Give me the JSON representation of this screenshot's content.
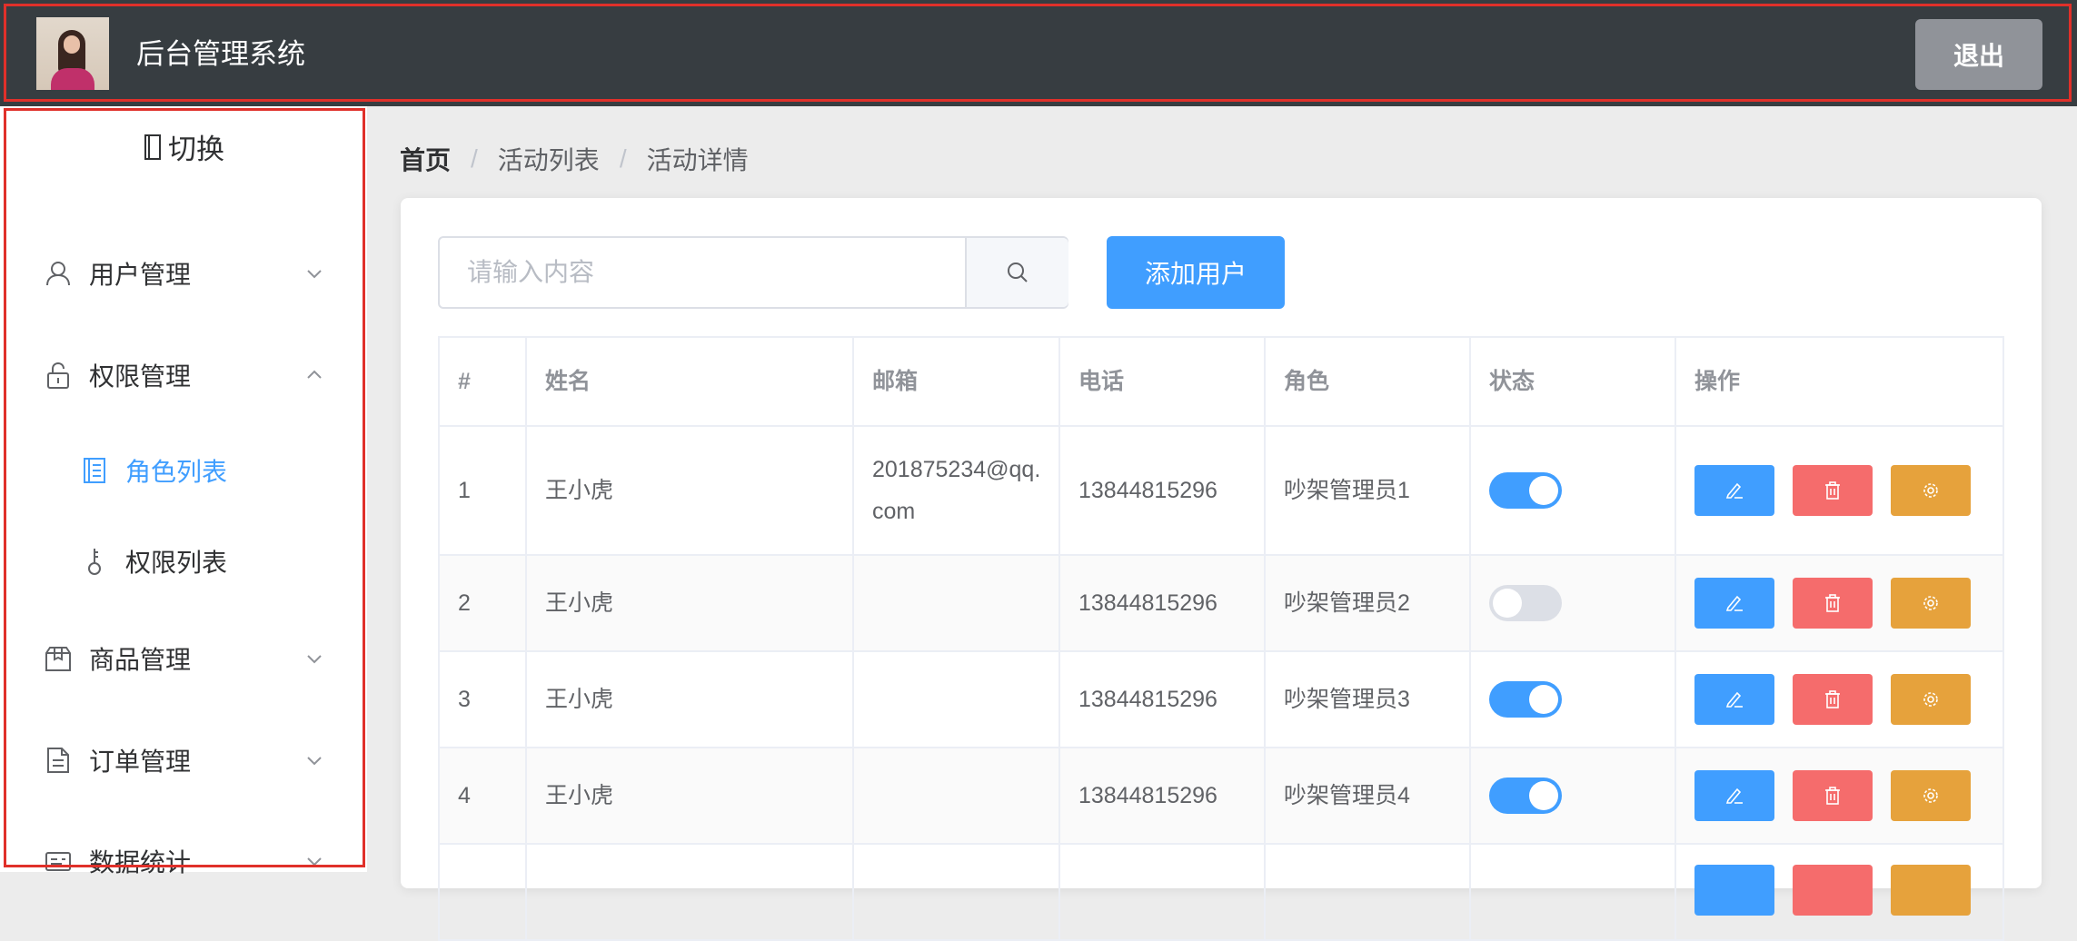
{
  "header": {
    "title": "后台管理系统",
    "logout_label": "退出"
  },
  "sidebar": {
    "toggle_label": "切换",
    "items": [
      {
        "label": "用户管理",
        "icon": "user-icon",
        "expanded": false
      },
      {
        "label": "权限管理",
        "icon": "lock-icon",
        "expanded": true
      },
      {
        "label": "角色列表",
        "icon": "list-icon",
        "sub": true,
        "active": true
      },
      {
        "label": "权限列表",
        "icon": "key-icon",
        "sub": true,
        "active": false
      },
      {
        "label": "商品管理",
        "icon": "box-icon",
        "expanded": false
      },
      {
        "label": "订单管理",
        "icon": "document-icon",
        "expanded": false
      },
      {
        "label": "数据统计",
        "icon": "chart-card-icon",
        "expanded": false
      }
    ]
  },
  "breadcrumb": [
    "首页",
    "活动列表",
    "活动详情"
  ],
  "search": {
    "placeholder": "请输入内容",
    "value": ""
  },
  "add_button_label": "添加用户",
  "table": {
    "columns": [
      "#",
      "姓名",
      "邮箱",
      "电话",
      "角色",
      "状态",
      "操作"
    ],
    "rows": [
      {
        "index": "1",
        "name": "王小虎",
        "email_line1": "201875234@qq.",
        "email_line2": "com",
        "phone": "13844815296",
        "role": "吵架管理员1",
        "status": true
      },
      {
        "index": "2",
        "name": "王小虎",
        "email_line1": "",
        "email_line2": "",
        "phone": "13844815296",
        "role": "吵架管理员2",
        "status": false
      },
      {
        "index": "3",
        "name": "王小虎",
        "email_line1": "",
        "email_line2": "",
        "phone": "13844815296",
        "role": "吵架管理员3",
        "status": true
      },
      {
        "index": "4",
        "name": "王小虎",
        "email_line1": "",
        "email_line2": "",
        "phone": "13844815296",
        "role": "吵架管理员4",
        "status": true
      }
    ]
  },
  "colors": {
    "header_bg": "#373d41",
    "primary": "#409eff",
    "danger": "#f56c6c",
    "warning": "#e6a23c",
    "highlight_border": "#e0302a"
  }
}
